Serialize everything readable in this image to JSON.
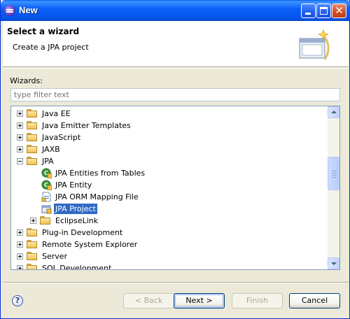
{
  "window": {
    "title": "New"
  },
  "header": {
    "title": "Select a wizard",
    "description": "Create a JPA project"
  },
  "wizards_label": "Wizards:",
  "filter": {
    "placeholder": "type filter text",
    "value": ""
  },
  "tree": {
    "items": [
      {
        "label": "Java EE",
        "type": "folder",
        "expanded": false
      },
      {
        "label": "Java Emitter Templates",
        "type": "folder",
        "expanded": false
      },
      {
        "label": "JavaScript",
        "type": "folder",
        "expanded": false
      },
      {
        "label": "JAXB",
        "type": "folder",
        "expanded": false
      },
      {
        "label": "JPA",
        "type": "folder",
        "expanded": true
      },
      {
        "label": "JPA Entities from Tables",
        "type": "wizard",
        "icon": "jpa-entities-icon"
      },
      {
        "label": "JPA Entity",
        "type": "wizard",
        "icon": "jpa-entity-icon"
      },
      {
        "label": "JPA ORM Mapping File",
        "type": "wizard",
        "icon": "orm-file-icon"
      },
      {
        "label": "JPA Project",
        "type": "wizard",
        "icon": "jpa-project-icon",
        "selected": true
      },
      {
        "label": "EclipseLink",
        "type": "folder",
        "expanded": false
      },
      {
        "label": "Plug-in Development",
        "type": "folder",
        "expanded": false
      },
      {
        "label": "Remote System Explorer",
        "type": "folder",
        "expanded": false
      },
      {
        "label": "Server",
        "type": "folder",
        "expanded": false
      },
      {
        "label": "SQL Development",
        "type": "folder",
        "expanded": false
      }
    ]
  },
  "buttons": {
    "back": "< Back",
    "next": "Next >",
    "finish": "Finish",
    "cancel": "Cancel"
  },
  "colors": {
    "selection": "#316ac5",
    "titlebar": "#0a61f8",
    "dialog": "#ece9d8"
  }
}
